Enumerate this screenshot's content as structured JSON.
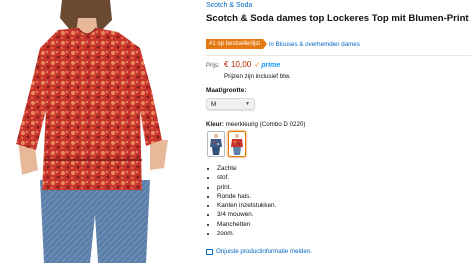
{
  "product": {
    "brand": "Scotch & Soda",
    "title": "Scotch & Soda dames top Lockeres Top mit Blumen-Print",
    "image_icon": "product-photo-woman-red-floral-blouse"
  },
  "bestseller": {
    "badge": "#1 op bestsellerlijst",
    "category_link": "in Blouses & overhemden dames",
    "badge_color": "#e47911"
  },
  "price": {
    "label": "Prijs:",
    "value": "€ 10,00",
    "prime_label": "prime",
    "prime_check": "✓",
    "vat_note": "Prijzen zijn inclusief btw.",
    "price_color": "#b12704"
  },
  "size": {
    "label": "Maat/grootte:",
    "selected": "M"
  },
  "color": {
    "label": "Kleur:",
    "value": "meerkleurig (Combo D 0220)",
    "swatches": [
      "blue-floral-variant",
      "red-floral-variant"
    ]
  },
  "bullets": [
    "Zachte",
    "stof.",
    "print.",
    "Ronde hals.",
    "Kanten inzetstukken.",
    "3/4 mouwen.",
    "Manchetten",
    "zoom."
  ],
  "report_link": "Onjuiste productinformatie melden.",
  "link_color": "#0066c0"
}
